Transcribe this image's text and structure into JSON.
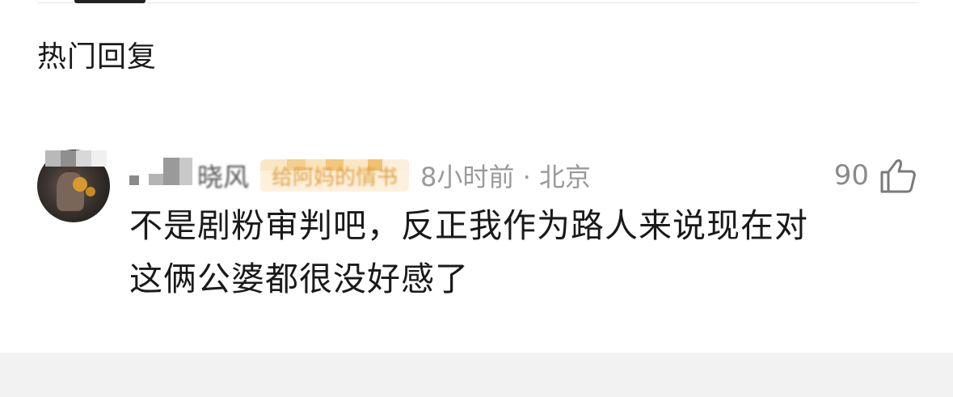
{
  "section_title": "热门回复",
  "comment": {
    "username": "晓风",
    "badge": "给阿妈的情书",
    "time": "8小时前",
    "separator": "·",
    "location": "北京",
    "likes": "90",
    "body_line1": "不是剧粉审判吧，反正我作为路人来说现在对",
    "body_line2": "这俩公婆都很没好感了",
    "avatar_icon": "avatar-image",
    "like_icon": "thumbs-up-icon"
  },
  "colors": {
    "text_primary": "#1a1a1a",
    "text_secondary": "#9a9a9a",
    "badge_bg": "#fdf1de",
    "badge_text": "#e0a040",
    "bottom_band": "#f2f2f2"
  }
}
